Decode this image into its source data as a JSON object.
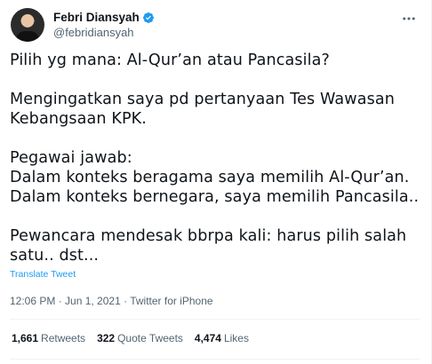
{
  "author": {
    "display_name": "Febri Diansyah",
    "handle": "@febridiansyah",
    "verified": true,
    "avatar_icon": "profile-photo"
  },
  "more_icon": "ellipsis-icon",
  "tweet": {
    "text": "Pilih yg mana: Al-Qur’an atau Pancasila?\n\nMengingatkan saya pd pertanyaan Tes Wawasan Kebangsaan KPK.\n\nPegawai jawab:\nDalam konteks beragama saya memilih Al-Qur’an.\nDalam konteks bernegara, saya memilih Pancasila..\n\nPewancara mendesak bbrpa kali: harus pilih salah satu.. dst...",
    "translate_label": "Translate Tweet",
    "meta": "12:06 PM · Jun 1, 2021 · Twitter for iPhone"
  },
  "stats": {
    "retweets_count": "1,661",
    "retweets_label": "Retweets",
    "quotes_count": "322",
    "quotes_label": "Quote Tweets",
    "likes_count": "4,474",
    "likes_label": "Likes"
  },
  "colors": {
    "link": "#1d9bf0",
    "secondary_text": "#536471",
    "primary_text": "#0f1419",
    "divider": "#eff3f4"
  }
}
